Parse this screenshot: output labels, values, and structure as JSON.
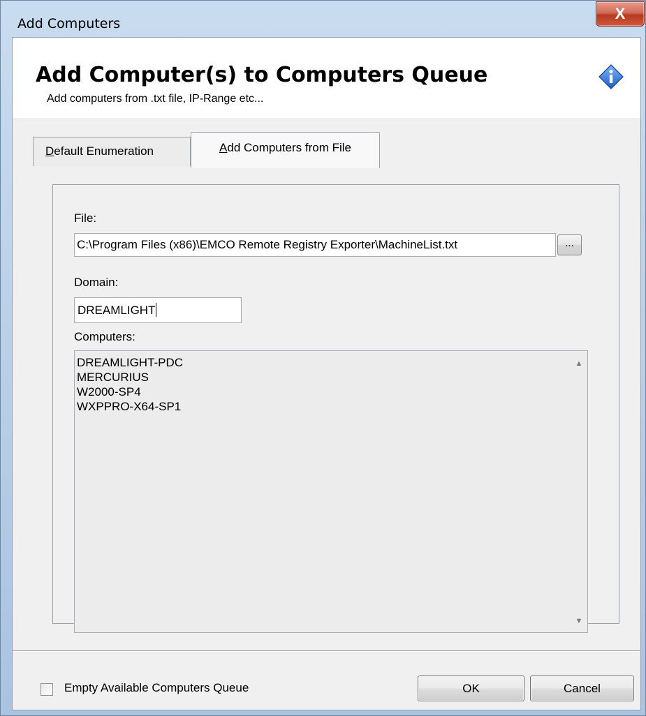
{
  "window": {
    "title": "Add Computers",
    "close_glyph": "X"
  },
  "header": {
    "title": "Add Computer(s) to Computers Queue",
    "subtitle": "Add computers from .txt file, IP-Range etc...",
    "icon": "info-icon"
  },
  "tabs": [
    {
      "label_accel": "D",
      "label_rest": "efault Enumeration",
      "selected": false
    },
    {
      "label_accel": "A",
      "label_rest": "dd Computers from File",
      "selected": true
    }
  ],
  "form": {
    "file_label": "File:",
    "file_value": "C:\\Program Files (x86)\\EMCO Remote Registry Exporter\\MachineList.txt",
    "browse_label": "...",
    "domain_label": "Domain:",
    "domain_value": "DREAMLIGHT",
    "computers_label": "Computers:",
    "computers": [
      "DREAMLIGHT-PDC",
      "MERCURIUS",
      "W2000-SP4",
      "WXPPRO-X64-SP1"
    ]
  },
  "footer": {
    "empty_queue_label": "Empty Available Computers Queue",
    "empty_queue_checked": false,
    "ok_label": "OK",
    "cancel_label": "Cancel"
  }
}
